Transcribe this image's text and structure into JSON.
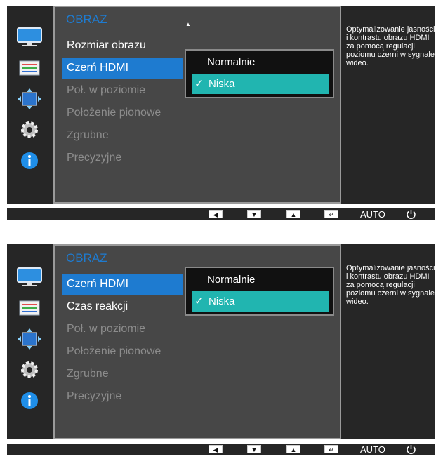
{
  "panels": [
    {
      "title": "OBRAZ",
      "menu_items": [
        {
          "label": "Rozmiar obrazu",
          "state": "active"
        },
        {
          "label": "Czerń HDMI",
          "state": "selected"
        },
        {
          "label": "Poł. w poziomie",
          "state": "dim"
        },
        {
          "label": "Położenie pionowe",
          "state": "dim"
        },
        {
          "label": "Zgrubne",
          "state": "dim"
        },
        {
          "label": "Precyzyjne",
          "state": "dim"
        }
      ],
      "options": [
        {
          "label": "Normalnie",
          "checked": false
        },
        {
          "label": "Niska",
          "checked": true
        }
      ],
      "description": "Optymalizowanie jasności i kontrastu obrazu HDMI za pomocą regulacji poziomu czerni w sygnale wideo."
    },
    {
      "title": "OBRAZ",
      "menu_items": [
        {
          "label": "Czerń HDMI",
          "state": "selected"
        },
        {
          "label": "Czas reakcji",
          "state": "active"
        },
        {
          "label": "Poł. w poziomie",
          "state": "dim"
        },
        {
          "label": "Położenie pionowe",
          "state": "dim"
        },
        {
          "label": "Zgrubne",
          "state": "dim"
        },
        {
          "label": "Precyzyjne",
          "state": "dim"
        }
      ],
      "options": [
        {
          "label": "Normalnie",
          "checked": false
        },
        {
          "label": "Niska",
          "checked": true
        }
      ],
      "description": "Optymalizowanie jasności i kontrastu obrazu HDMI za pomocą regulacji poziomu czerni w sygnale wideo."
    }
  ],
  "buttons": {
    "left": "◀",
    "down": "▼",
    "up": "▲",
    "enter": "↵",
    "auto": "AUTO",
    "power_icon": "power-icon"
  },
  "colors": {
    "accent_blue": "#1e7bd0",
    "check_teal": "#21b5b0",
    "osd_dark": "#262626",
    "osd_main": "#474747"
  }
}
